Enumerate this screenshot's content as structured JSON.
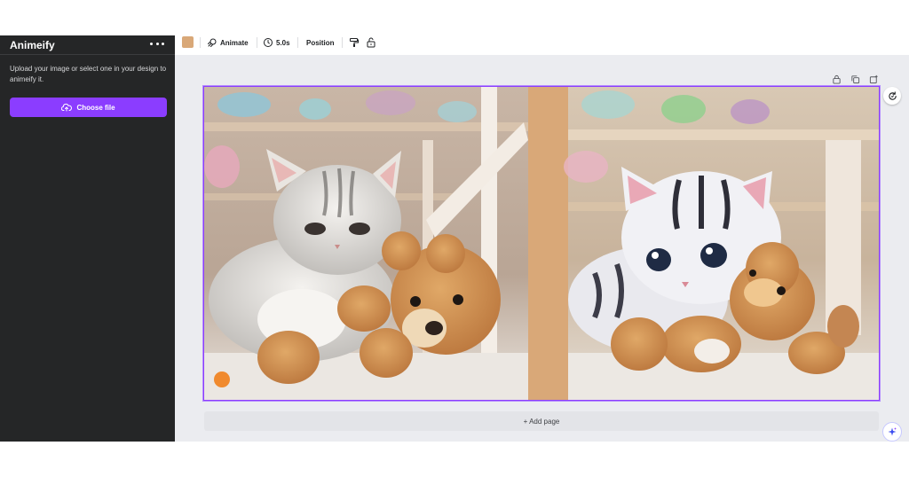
{
  "sidebar": {
    "title": "Animeify",
    "description": "Upload your image or select one in your design to animeify it.",
    "choose_file_label": "Choose file"
  },
  "toolbar": {
    "swatch_color": "#d9a878",
    "animate_label": "Animate",
    "duration_label": "5.0s",
    "position_label": "Position"
  },
  "canvas": {
    "left_image": "photo-kitten-with-teddy-bear",
    "right_image": "anime-kitten-with-teddy-bear",
    "selection_color": "#8b3dff"
  },
  "add_page_label": "+ Add page",
  "icons": {
    "more": "more-dots-icon",
    "upload": "cloud-upload-icon",
    "animate": "animate-icon",
    "clock": "clock-icon",
    "paint_roller": "paint-roller-icon",
    "unlock": "unlock-icon",
    "page_lock": "lock-icon",
    "duplicate": "duplicate-page-icon",
    "share": "add-page-icon",
    "refresh": "refresh-icon",
    "magic": "magic-sparkle-icon",
    "collapse": "chevron-left-icon"
  }
}
